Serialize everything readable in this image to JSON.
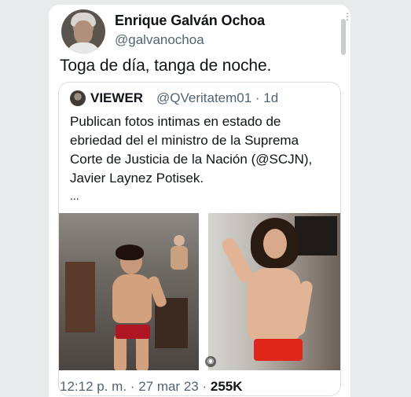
{
  "tweet": {
    "display_name": "Enrique Galván Ochoa",
    "handle": "@galvanochoa",
    "text": "Toga de día, tanga de noche.",
    "more_icon": "more-icon",
    "time": "12:12 p. m.",
    "date": "27 mar 23",
    "views": "255K"
  },
  "quote": {
    "name": "VIEWER",
    "handle_time": "@QVeritatem01 · 1d",
    "text": "Publican fotos intimas en estado de ebriedad del el ministro de la Suprema Corte de Justicia de la Nación (@SCJN), Javier Laynez Potisek.",
    "ellipsis": "...",
    "media_count_icon": "gif-badge-icon"
  },
  "colors": {
    "background": "#e9eaeb",
    "card": "#ffffff",
    "secondary_text": "#536471",
    "primary_text": "#0f1419",
    "briefs_left": "#b01622",
    "briefs_right": "#e0261b"
  }
}
